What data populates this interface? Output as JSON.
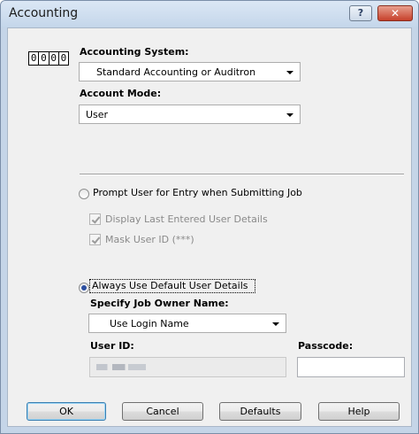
{
  "window": {
    "title": "Accounting"
  },
  "titlebar": {
    "help_glyph": "?",
    "close_glyph": "✕"
  },
  "counter_icon": {
    "digits": [
      "0",
      "0",
      "0",
      "0"
    ]
  },
  "accounting_system": {
    "label": "Accounting System:",
    "value": "Standard Accounting or Auditron"
  },
  "account_mode": {
    "label": "Account Mode:",
    "value": "User"
  },
  "prompt_user": {
    "label": "Prompt User for Entry when Submitting Job",
    "selected": false,
    "display_last": {
      "label": "Display Last Entered User Details",
      "checked": true
    },
    "mask_user_id": {
      "label": "Mask User ID (***)",
      "checked": true
    }
  },
  "always_default": {
    "label": "Always Use Default User Details",
    "selected": true,
    "owner_name_label": "Specify Job Owner Name:",
    "owner_name_value": "Use Login Name",
    "user_id_label": "User ID:",
    "passcode_label": "Passcode:"
  },
  "buttons": {
    "ok": "OK",
    "cancel": "Cancel",
    "defaults": "Defaults",
    "help": "Help"
  },
  "colors": {
    "selected_radio": "#2b4ea0",
    "default_button_border": "#3c7fb1",
    "close_button": "#c6402a"
  }
}
